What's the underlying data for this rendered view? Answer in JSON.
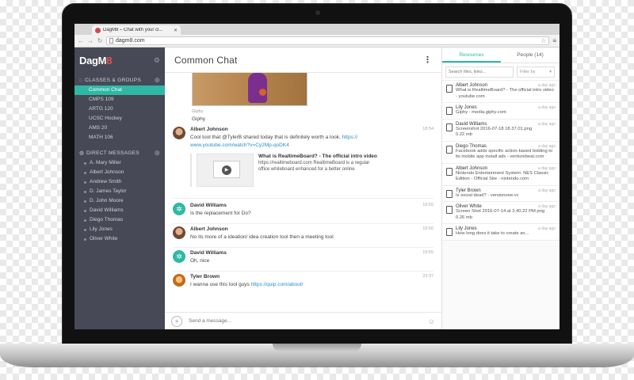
{
  "browser": {
    "tab_title": "DagM8 – Chat with your cl...",
    "url": "dagm8.com"
  },
  "sidebar": {
    "brand_text": "DagM",
    "brand_accent": "8",
    "classes_label": "CLASSES & GROUPS",
    "channels": [
      "Common Chat",
      "CMPS 109",
      "ARTG 120",
      "UCSC Hockey",
      "AMS 20",
      "MATH 106"
    ],
    "dm_label": "DIRECT MESSAGES",
    "direct_messages": [
      "A. Mary Miller",
      "Albert Johnson",
      "Andrew Smith",
      "D. James Taylor",
      "D. John Moore",
      "David Williams",
      "Diego Thomas",
      "Lily Jones",
      "Oliver White"
    ]
  },
  "main": {
    "title": "Common Chat",
    "giphy_source": "Giphy",
    "giphy_name": "Giphy",
    "messages": [
      {
        "author": "Albert Johnson",
        "time": "18:54",
        "text": "Cool tool that @TylerB shared today that is definitely worth a look.",
        "link1": "https://",
        "link2": "www.youtube.com/watch?v=Cy2Mp-qoDK4",
        "preview_title": "What is RealtimeBoard? - The official intro video",
        "preview_domain": "https://realtimeboard.com",
        "preview_desc": "RealtimeBoard is a regular office whiteboard enhanced for a better online"
      },
      {
        "author": "David Williams",
        "time": "18:55",
        "text": "Is the replacement for Do?"
      },
      {
        "author": "Albert Johnson",
        "time": "18:56",
        "text": "No its more of a ideation/ idea creation tool then a meeting tool"
      },
      {
        "author": "David Williams",
        "time": "18:55",
        "text": "Oh, nice"
      },
      {
        "author": "Tyler Brown",
        "time": "23:37",
        "text": "I wanna use this tool guys",
        "link": "https://quip.com/about/"
      }
    ],
    "composer_placeholder": "Send a message..."
  },
  "resources": {
    "tab_resources": "Resources",
    "tab_people": "People (14)",
    "search_placeholder": "Search files, links...",
    "filter_label": "Filter by",
    "items": [
      {
        "author": "Albert Johnson",
        "time": "a day ago",
        "text": "What is RealtimeBoard? - The official intro video - youtube.com"
      },
      {
        "author": "Lily Jones",
        "time": "a day ago",
        "text": "Giphy - media.giphy.com"
      },
      {
        "author": "David Williams",
        "time": "a day ago",
        "text": "Screenshot 2016-07-18 18.37.01.png",
        "size": "0.22 mb"
      },
      {
        "author": "Diego Thomas",
        "time": "a day ago",
        "text": "Facebook adds specific action-based bidding to its mobile app install ads - venturebeat.com"
      },
      {
        "author": "Albert Johnson",
        "time": "a day ago",
        "text": "Nintendo Entertainment System: NES Classic Edition - Official Site - nintendo.com"
      },
      {
        "author": "Tyler Brown",
        "time": "a day ago",
        "text": "Is social dead? - versionone.vc"
      },
      {
        "author": "Oliver White",
        "time": "a day ago",
        "text": "Screen Shot 2016-07-14 at 3.40.22 PM.png",
        "size": "0.26 mb"
      },
      {
        "author": "Lily Jones",
        "time": "a day ago",
        "text": "How long does it take to create an..."
      }
    ]
  },
  "colors": {
    "accent": "#2fb8a5",
    "sidebar_bg": "#474956",
    "link": "#2b8ec9",
    "brand_red": "#e2574c"
  }
}
